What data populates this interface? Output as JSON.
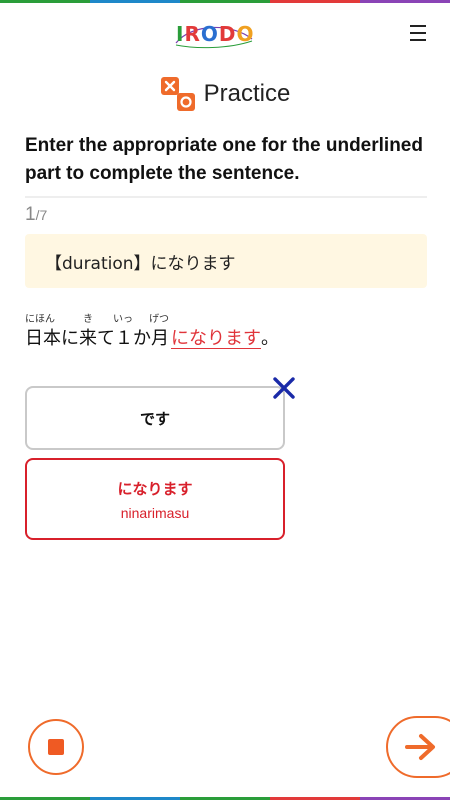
{
  "app": {
    "logo_text": "IRODORI",
    "logo_letters": [
      "I",
      "R",
      "O",
      "D",
      "O",
      "R",
      "I"
    ],
    "logo_colors": [
      "#2a9d3a",
      "#e23a3a",
      "#2a6fd0",
      "#e23a3a",
      "#f0a020",
      "#2a9d3a",
      "#7a3fb0"
    ],
    "menu_icon": "hamburger-menu-icon"
  },
  "header": {
    "section_icon": "practice-icon",
    "section_title": "Practice"
  },
  "question": {
    "instruction": "Enter the appropriate one for the underlined part to complete the sentence.",
    "progress_current": "1",
    "progress_total": "/7",
    "hint": "【duration】になります",
    "sentence": {
      "segments": [
        {
          "text": "日本",
          "ruby": "にほん"
        },
        {
          "text": "に",
          "ruby": ""
        },
        {
          "text": "来",
          "ruby": "き"
        },
        {
          "text": "て１",
          "ruby": ""
        },
        {
          "text": "か",
          "ruby": "いっ"
        },
        {
          "text": "月",
          "ruby": "げつ"
        }
      ],
      "target": "になります",
      "end_punct": "。"
    }
  },
  "choices": [
    {
      "label": "です",
      "romaji": "",
      "state": "wrong"
    },
    {
      "label": "になります",
      "romaji": "ninarimasu",
      "state": "correct"
    }
  ],
  "controls": {
    "stop_icon": "stop-icon",
    "next_icon": "arrow-right-icon"
  },
  "colors": {
    "accent": "#ef6b2b",
    "correct": "#d8202b",
    "wrong_mark": "#1a2aa8",
    "hint_bg": "#fff7e2"
  }
}
